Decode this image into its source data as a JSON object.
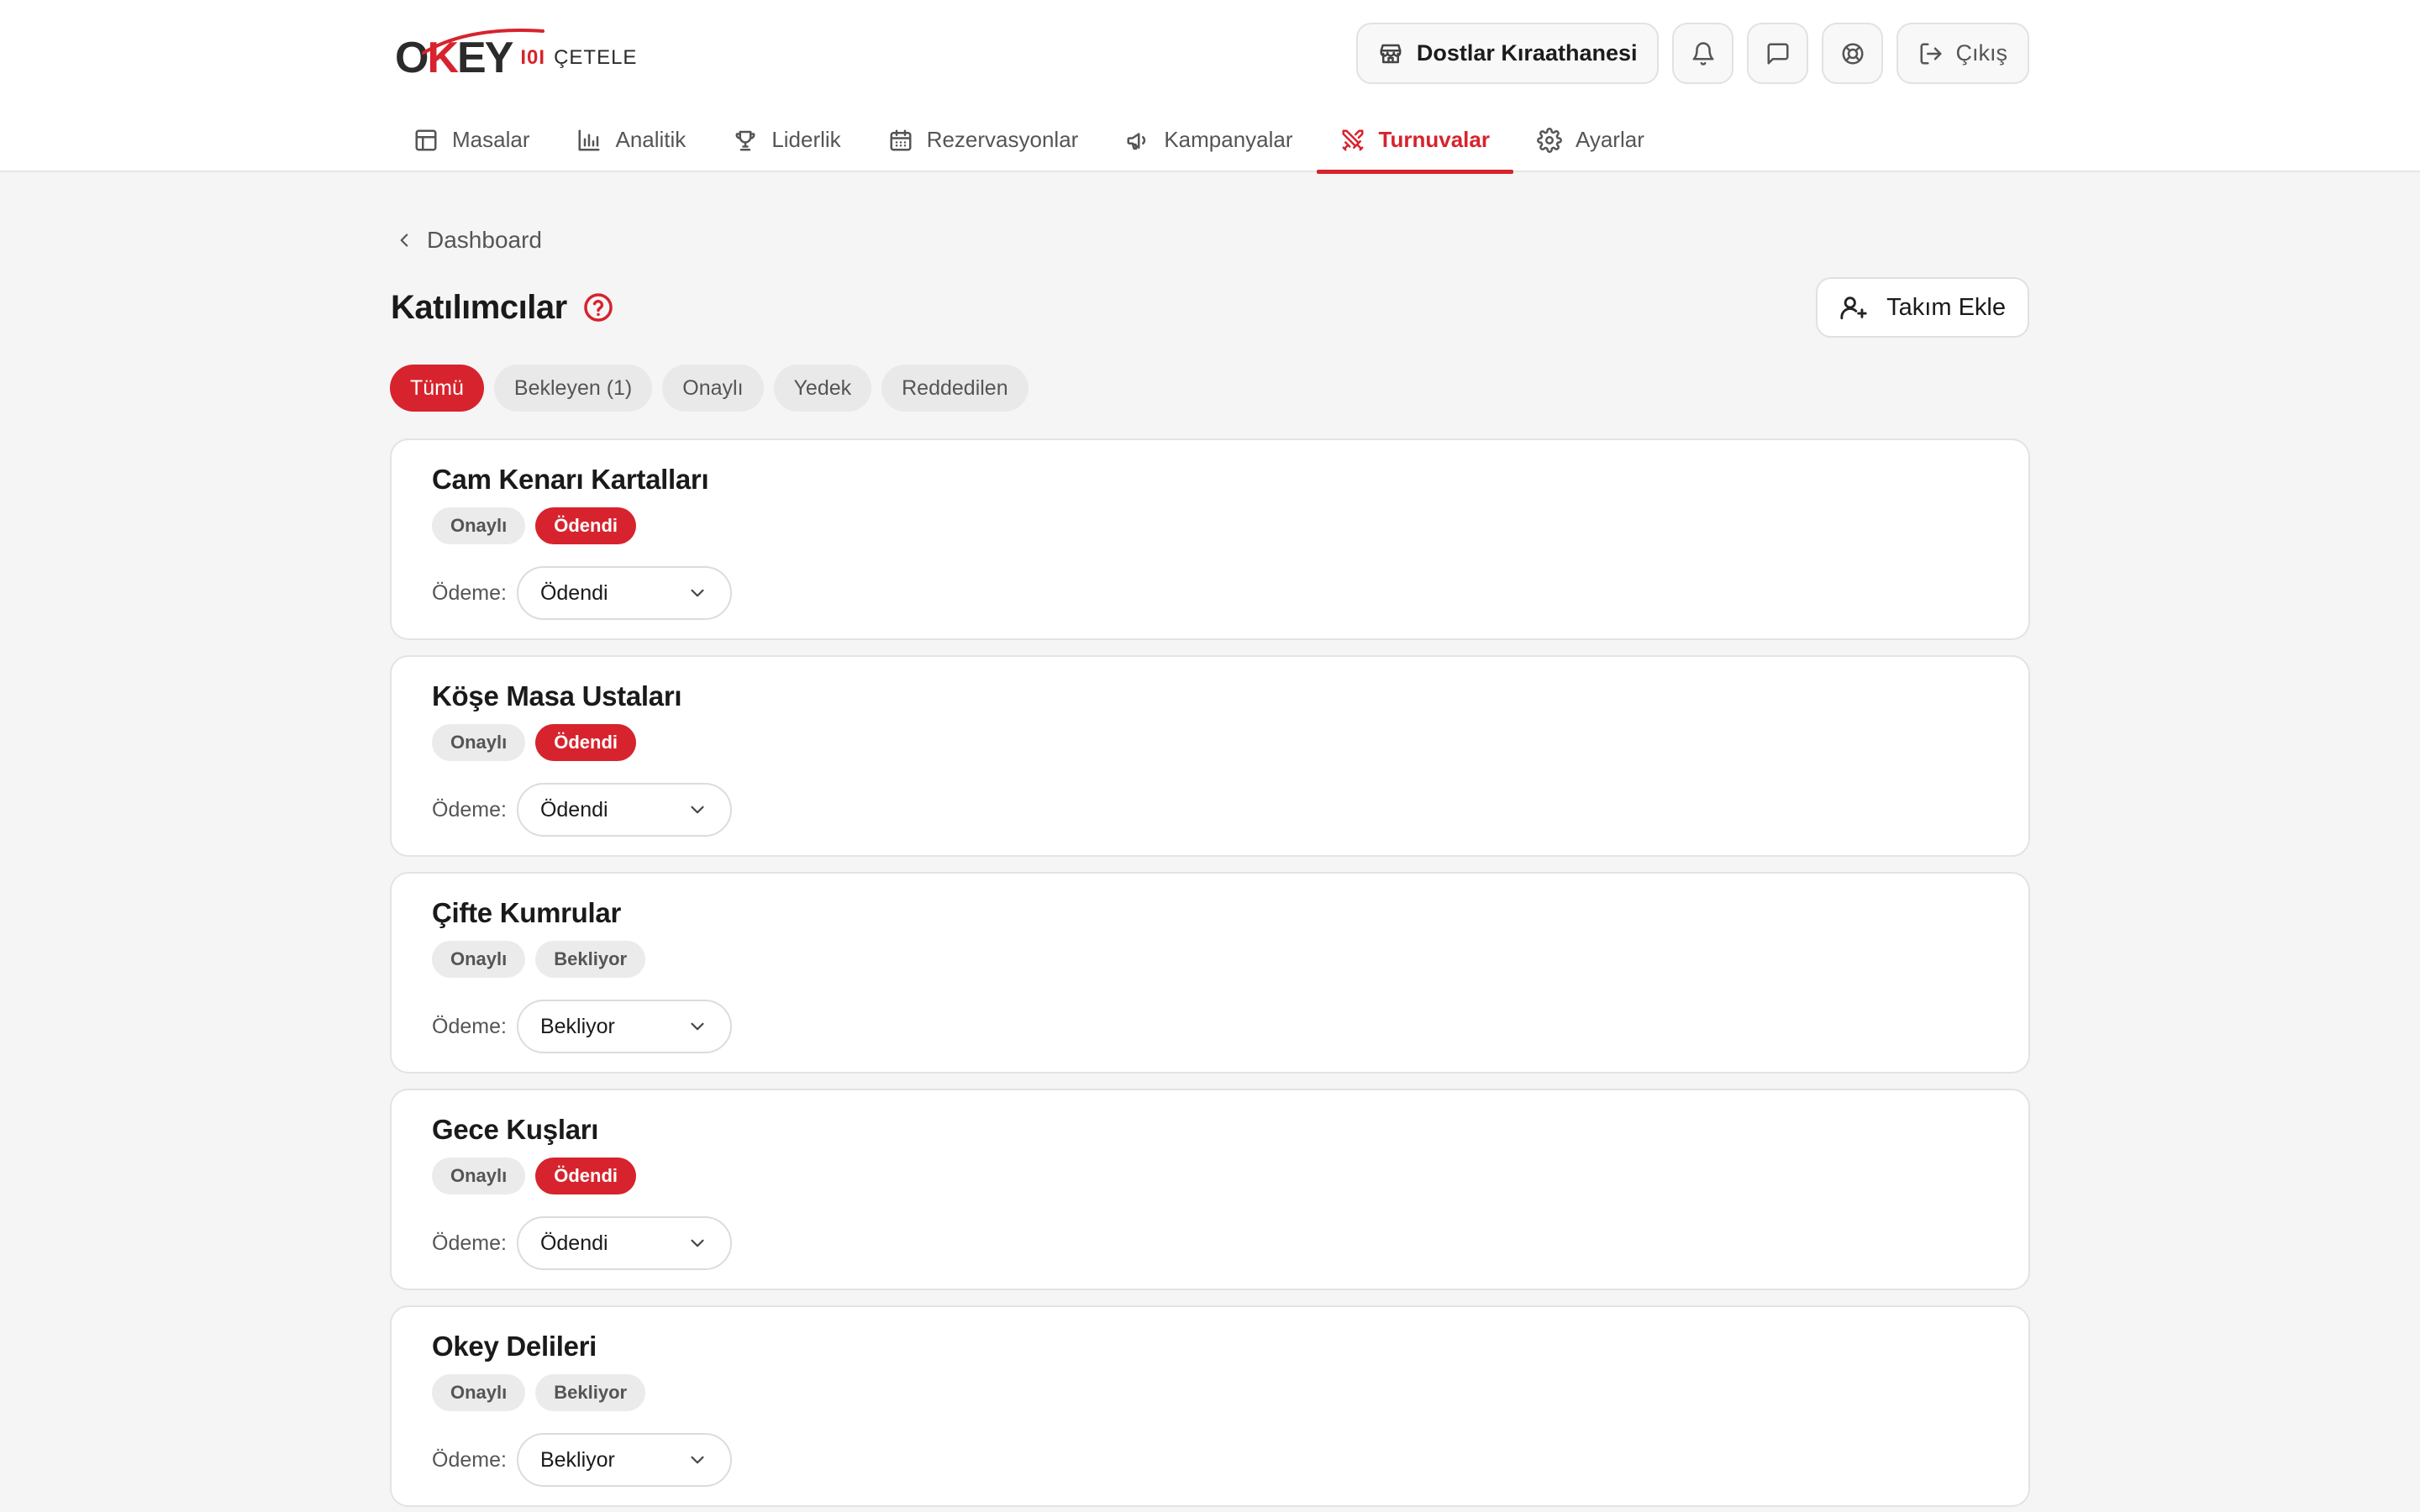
{
  "brand": {
    "name_part1": "O",
    "name_part2": "K",
    "name_part3": "EY",
    "divider": "I0I",
    "sub": "ÇETELE",
    "accent": "#d7232d"
  },
  "header": {
    "venue": "Dostlar Kıraathanesi",
    "logout": "Çıkış"
  },
  "nav": [
    {
      "label": "Masalar",
      "icon": "table-icon"
    },
    {
      "label": "Analitik",
      "icon": "chart-icon"
    },
    {
      "label": "Liderlik",
      "icon": "trophy-icon"
    },
    {
      "label": "Rezervasyonlar",
      "icon": "calendar-icon"
    },
    {
      "label": "Kampanyalar",
      "icon": "megaphone-icon"
    },
    {
      "label": "Turnuvalar",
      "icon": "swords-icon",
      "active": true
    },
    {
      "label": "Ayarlar",
      "icon": "gear-icon"
    }
  ],
  "breadcrumb": {
    "back_label": "Dashboard"
  },
  "page": {
    "title": "Katılımcılar",
    "add_team": "Takım Ekle"
  },
  "filters": [
    {
      "label": "Tümü",
      "active": true
    },
    {
      "label": "Bekleyen (1)"
    },
    {
      "label": "Onaylı"
    },
    {
      "label": "Yedek"
    },
    {
      "label": "Reddedilen"
    }
  ],
  "payment_label": "Ödeme:",
  "teams": [
    {
      "name": "Cam Kenarı Kartalları",
      "status": "Onaylı",
      "payment_badge": "Ödendi",
      "payment_value": "Ödendi"
    },
    {
      "name": "Köşe Masa Ustaları",
      "status": "Onaylı",
      "payment_badge": "Ödendi",
      "payment_value": "Ödendi"
    },
    {
      "name": "Çifte Kumrular",
      "status": "Onaylı",
      "payment_badge": "Bekliyor",
      "payment_value": "Bekliyor"
    },
    {
      "name": "Gece Kuşları",
      "status": "Onaylı",
      "payment_badge": "Ödendi",
      "payment_value": "Ödendi"
    },
    {
      "name": "Okey Delileri",
      "status": "Onaylı",
      "payment_badge": "Bekliyor",
      "payment_value": "Bekliyor"
    }
  ]
}
